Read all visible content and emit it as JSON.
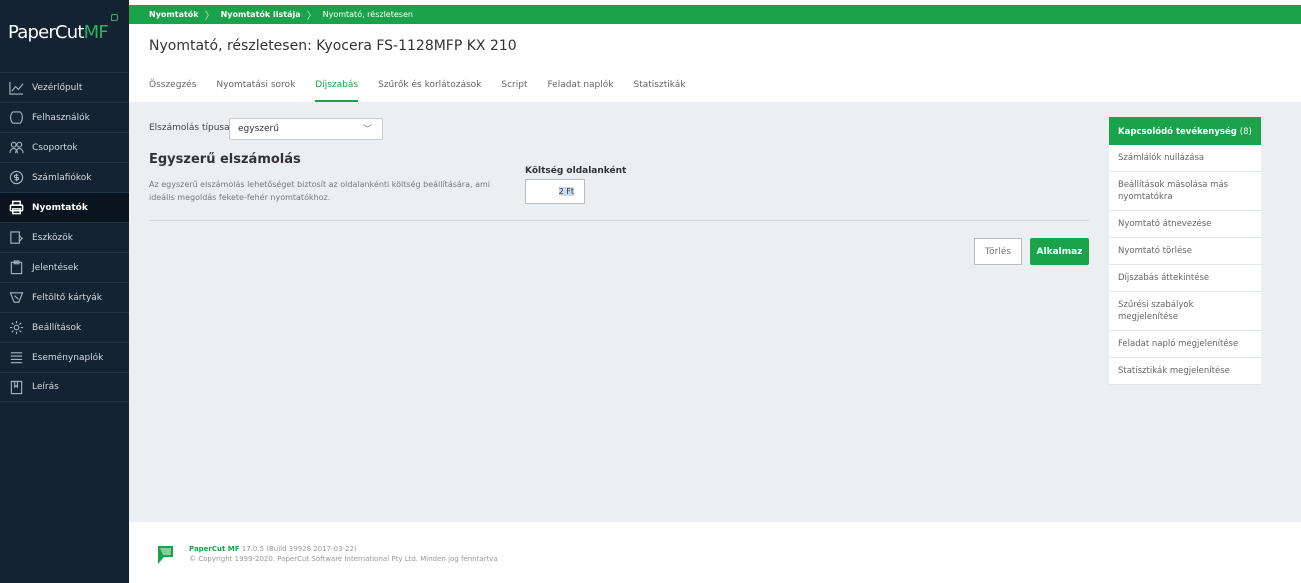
{
  "app": {
    "logo_main": "PaperCut",
    "logo_accent": "MF"
  },
  "sidebar": {
    "items": [
      {
        "label": "Vezérlőpult",
        "icon": "chart-line-icon",
        "active": false
      },
      {
        "label": "Felhasználók",
        "icon": "user-icon",
        "active": false
      },
      {
        "label": "Csoportok",
        "icon": "users-group-icon",
        "active": false
      },
      {
        "label": "Számlafiókok",
        "icon": "dollar-circle-icon",
        "active": false
      },
      {
        "label": "Nyomtatók",
        "icon": "printer-icon",
        "active": true
      },
      {
        "label": "Eszközök",
        "icon": "device-icon",
        "active": false
      },
      {
        "label": "Jelentések",
        "icon": "clipboard-icon",
        "active": false
      },
      {
        "label": "Feltöltő kártyák",
        "icon": "tag-icon",
        "active": false
      },
      {
        "label": "Beállítások",
        "icon": "gear-icon",
        "active": false
      },
      {
        "label": "Eseménynaplók",
        "icon": "list-icon",
        "active": false
      },
      {
        "label": "Leírás",
        "icon": "book-icon",
        "active": false
      }
    ]
  },
  "breadcrumb": [
    "Nyomtatók",
    "Nyomtatók listája",
    "Nyomtató, részletesen"
  ],
  "page": {
    "title": "Nyomtató, részletesen: Kyocera FS-1128MFP KX 210"
  },
  "tabs": [
    {
      "label": "Összegzés",
      "active": false
    },
    {
      "label": "Nyomtatási sorok",
      "active": false
    },
    {
      "label": "Díjszabás",
      "active": true
    },
    {
      "label": "Szűrők és korlátozások",
      "active": false
    },
    {
      "label": "Script",
      "active": false
    },
    {
      "label": "Feladat naplók",
      "active": false
    },
    {
      "label": "Statisztikák",
      "active": false
    }
  ],
  "form": {
    "billing_type_label": "Elszámolás típusa:",
    "billing_type_value": "egyszerű",
    "section_title": "Egyszerű elszámolás",
    "section_desc": "Az egyszerű elszámolás lehetőséget biztosít az oldalankénti költség beállítására, ami ideális megoldás fekete-fehér nyomtatókhoz.",
    "cost_label": "Költség oldalanként",
    "cost_value": "2 Ft",
    "reset_label": "Törlés",
    "apply_label": "Alkalmaz"
  },
  "related": {
    "title": "Kapcsolódó tevékenység",
    "count": "(8)",
    "items": [
      "Számlálók nullázása",
      "Beállítások másolása más nyomtatókra",
      "Nyomtató átnevezése",
      "Nyomtató törlése",
      "Díjszabás áttekintése",
      "Szűrési szabályok megjelenítése",
      "Feladat napló megjelenítése",
      "Statisztikák megjelenítése"
    ]
  },
  "footer": {
    "brand": "PaperCut MF",
    "version": "17.0.5 (Build 39928 2017-03-22)",
    "copyright": "© Copyright 1999-2020. PaperCut Software International Pty Ltd. Minden jog fenntartva"
  },
  "colors": {
    "brand_green": "#1aa34a",
    "sidebar_bg": "#142331",
    "content_bg": "#eceff2"
  }
}
